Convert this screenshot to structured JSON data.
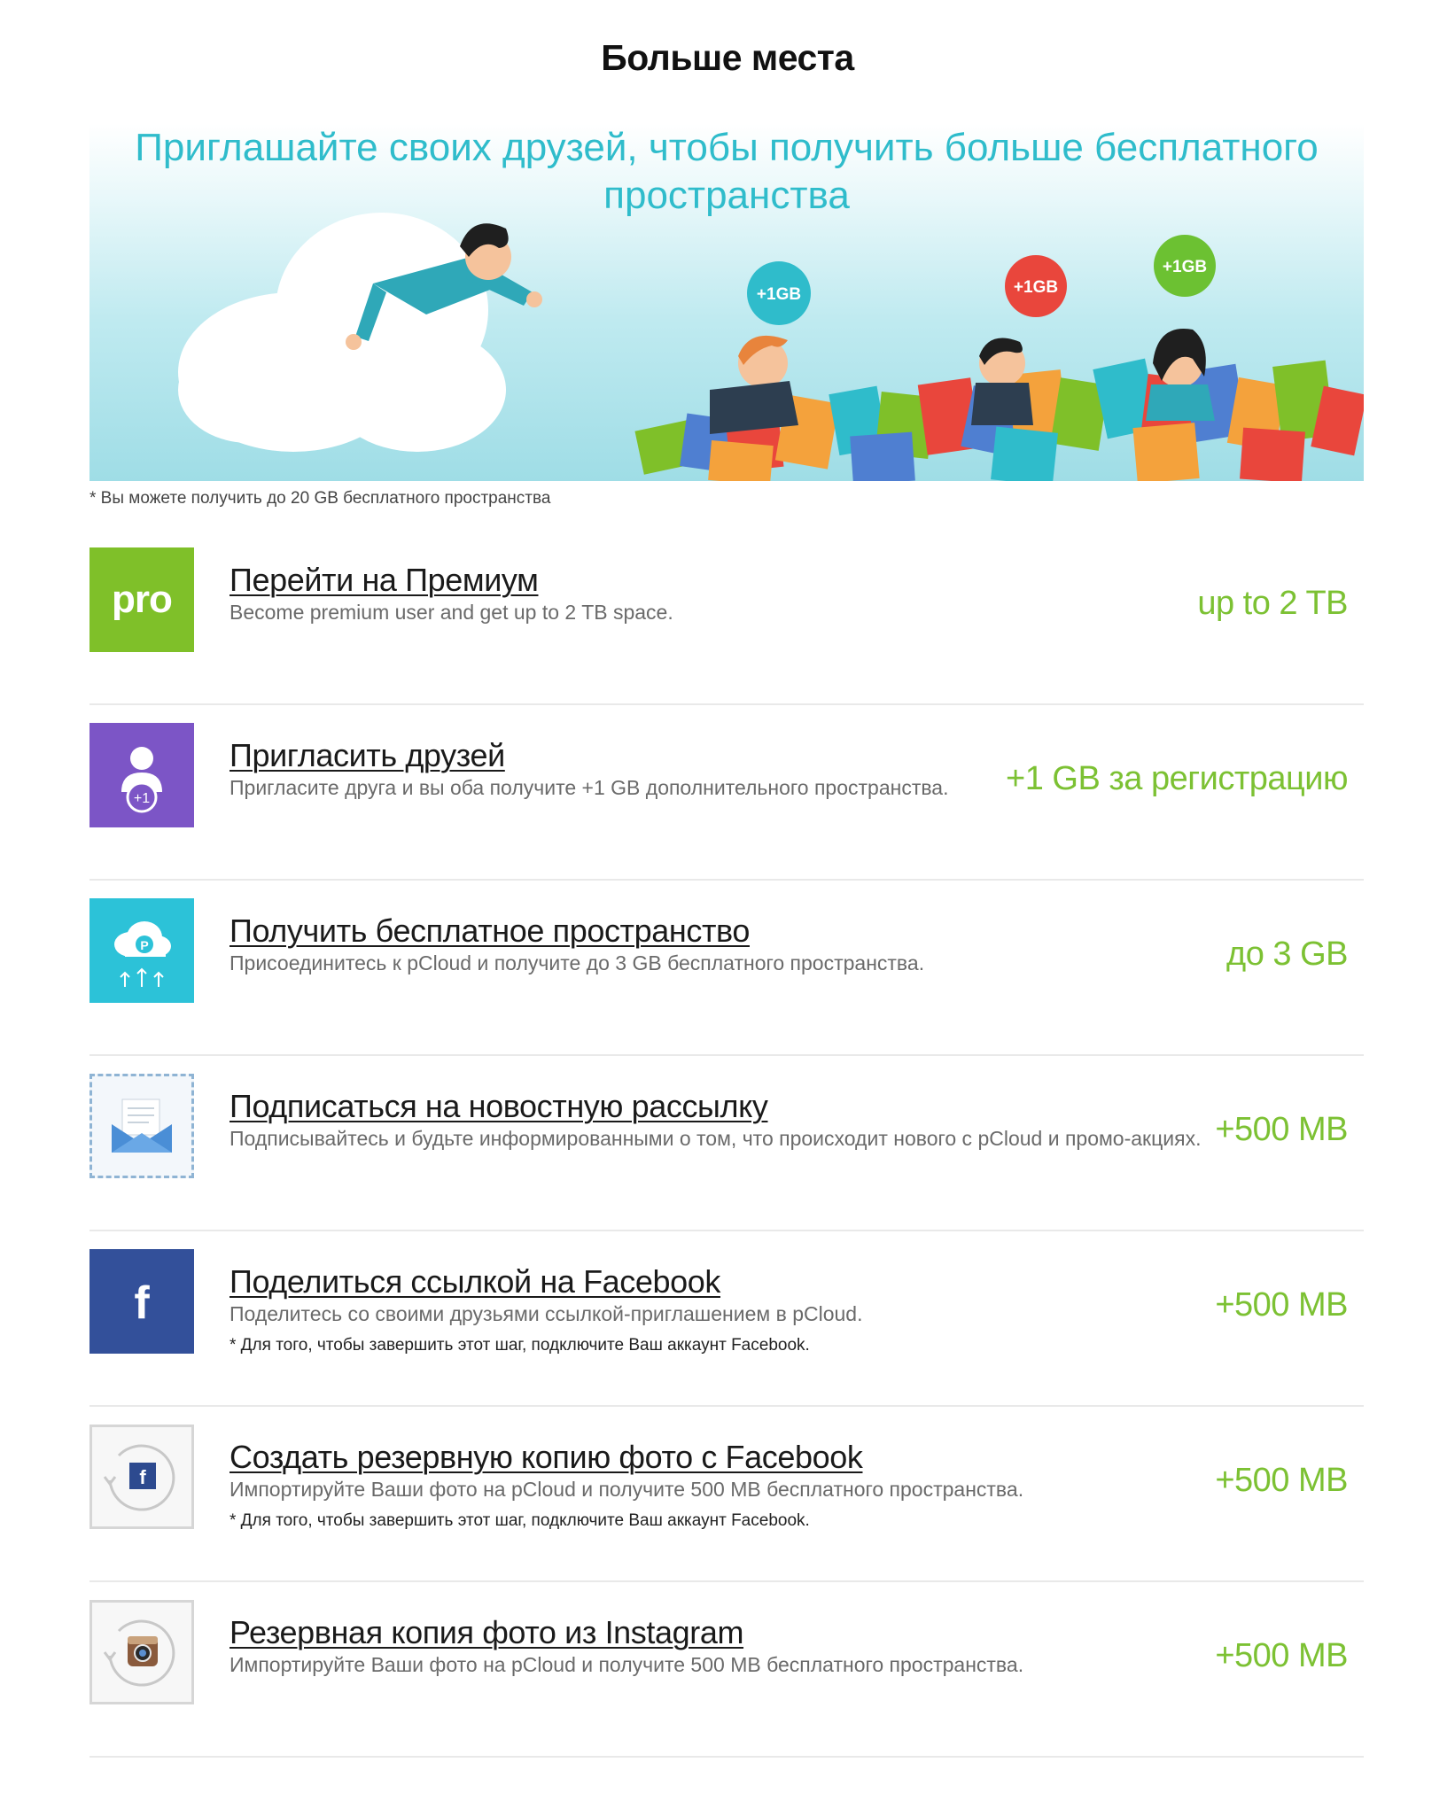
{
  "page": {
    "title": "Больше места"
  },
  "banner": {
    "headline_line1": "Приглашайте своих друзей, чтобы получить больше бесплатного",
    "headline_line2": "пространства",
    "bubbles": [
      {
        "label": "+1GB",
        "color": "#2fbccb"
      },
      {
        "label": "+1GB",
        "color": "#e9463c"
      },
      {
        "label": "+1GB",
        "color": "#6cc132"
      }
    ]
  },
  "footnote": "* Вы можете получить до 20 GB бесплатного пространства",
  "colors": {
    "accent_green": "#7cc133",
    "banner_teal": "#2fbccb"
  },
  "items": [
    {
      "icon": "pro-icon",
      "icon_text": "pro",
      "title": "Перейти на Премиум",
      "description": "Become premium user and get up to 2 TB space.",
      "note": "",
      "amount": "up to 2 TB"
    },
    {
      "icon": "invite-friend-icon",
      "icon_text": "+1",
      "title": "Пригласить друзей",
      "description": "Пригласите друга и вы оба получите +1 GB дополнительного пространства.",
      "note": "",
      "amount": "+1 GB за регистрацию"
    },
    {
      "icon": "pcloud-upload-icon",
      "icon_text": "P",
      "title": "Получить бесплатное пространство",
      "description": "Присоединитесь к pCloud и получите до 3 GB бесплатного пространства.",
      "note": "",
      "amount": "до 3 GB"
    },
    {
      "icon": "newsletter-envelope-icon",
      "title": "Подписаться на новостную рассылку",
      "description": "Подписывайтесь и будьте информированными о том, что происходит нового с pCloud и промо-акциях.",
      "note": "",
      "amount": "+500 MB"
    },
    {
      "icon": "facebook-icon",
      "icon_text": "f",
      "title": "Поделиться ссылкой на Facebook",
      "description": "Поделитесь со своими друзьями ссылкой-приглашением в pCloud.",
      "note": "* Для того, чтобы завершить этот шаг, подключите Ваш аккаунт Facebook.",
      "amount": "+500 MB"
    },
    {
      "icon": "facebook-backup-icon",
      "icon_text": "f",
      "title": "Создать резервную копию фото с Facebook",
      "description": "Импортируйте Ваши фото на pCloud и получите 500 MB бесплатного пространства.",
      "note": "* Для того, чтобы завершить этот шаг, подключите Ваш аккаунт Facebook.",
      "amount": "+500 MB"
    },
    {
      "icon": "instagram-backup-icon",
      "title": "Резервная копия фото из Instagram",
      "description": "Импортируйте Ваши фото на pCloud и получите 500 MB бесплатного пространства.",
      "note": "",
      "amount": "+500 MB"
    }
  ]
}
